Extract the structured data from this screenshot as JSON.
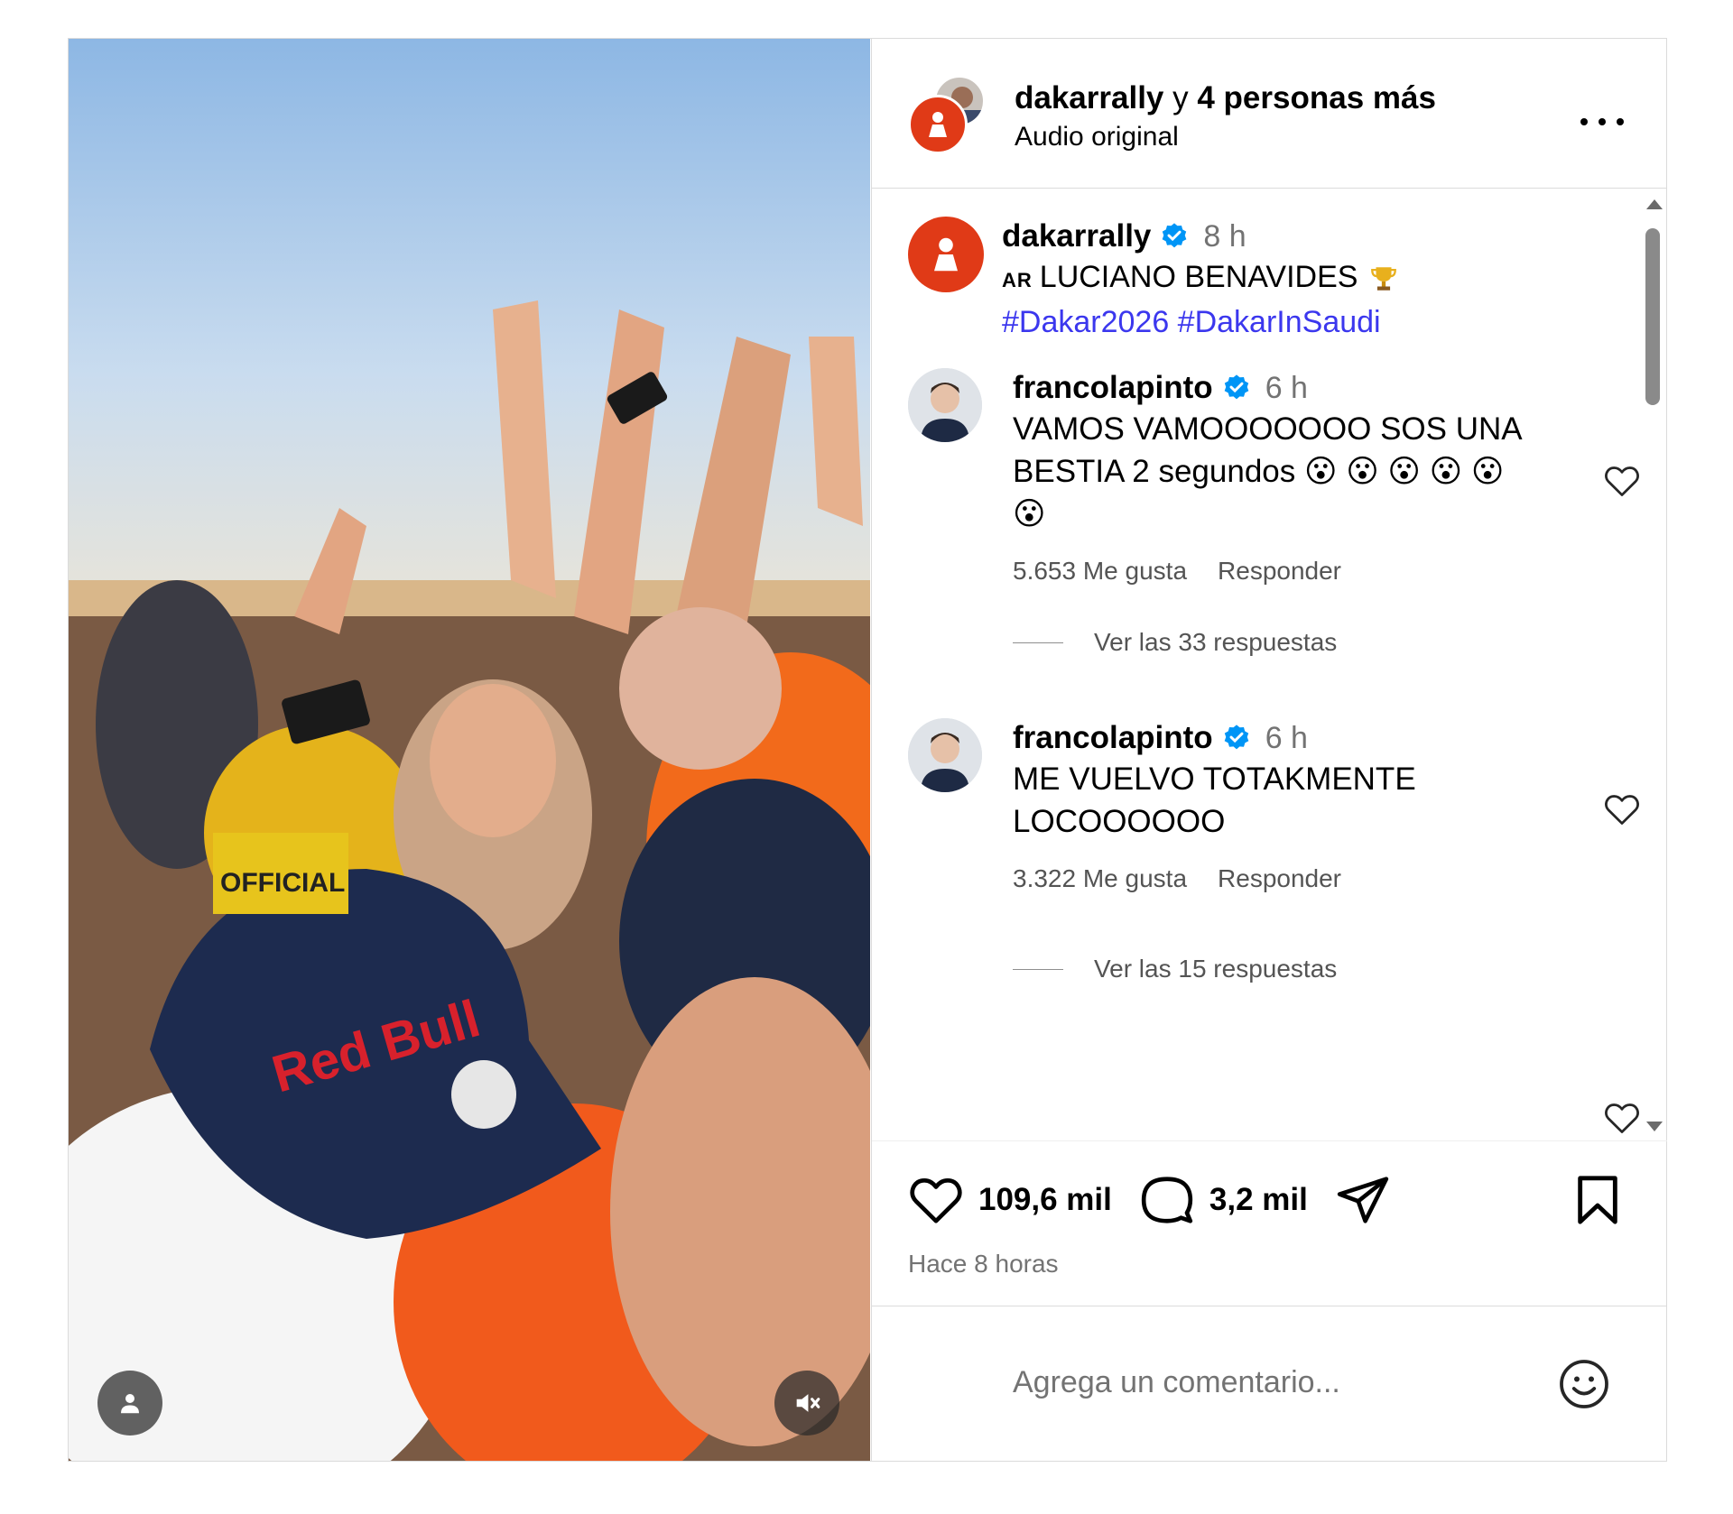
{
  "header": {
    "username": "dakarrally",
    "connector": " y ",
    "others": "4 personas más",
    "audio": "Audio original"
  },
  "caption": {
    "username": "dakarrally",
    "time": "8 h",
    "flag": "AR",
    "text": "LUCIANO BENAVIDES",
    "hashtags": "#Dakar2026 #DakarInSaudi"
  },
  "comments": [
    {
      "username": "francolapinto",
      "time": "6 h",
      "text": "VAMOS VAMOOOOOOO SOS UNA BESTIA 2 segundos 😮 😮 😮 😮 😮 😮",
      "likes": "5.653 Me gusta",
      "reply": "Responder",
      "replies": "Ver las 33 respuestas"
    },
    {
      "username": "francolapinto",
      "time": "6 h",
      "text": "ME VUELVO TOTAKMENTE LOCOOOOOO",
      "likes": "3.322 Me gusta",
      "reply": "Responder",
      "replies": "Ver las 15 respuestas"
    }
  ],
  "actions": {
    "likes": "109,6 mil",
    "comments": "3,2 mil",
    "posted": "Hace 8 horas"
  },
  "composer": {
    "placeholder": "Agrega un comentario..."
  },
  "media_overlay": {
    "cap_text": "Red Bull",
    "badge_text": "OFFICIAL"
  },
  "colors": {
    "accent_blue": "#0095f6",
    "hashtag": "#3b37ee",
    "brand_red": "#e03a17"
  },
  "icons": [
    "more-icon",
    "verified-icon",
    "trophy-icon",
    "heart-icon",
    "comment-icon",
    "share-icon",
    "bookmark-icon",
    "emoji-icon",
    "user-icon",
    "mute-icon"
  ]
}
